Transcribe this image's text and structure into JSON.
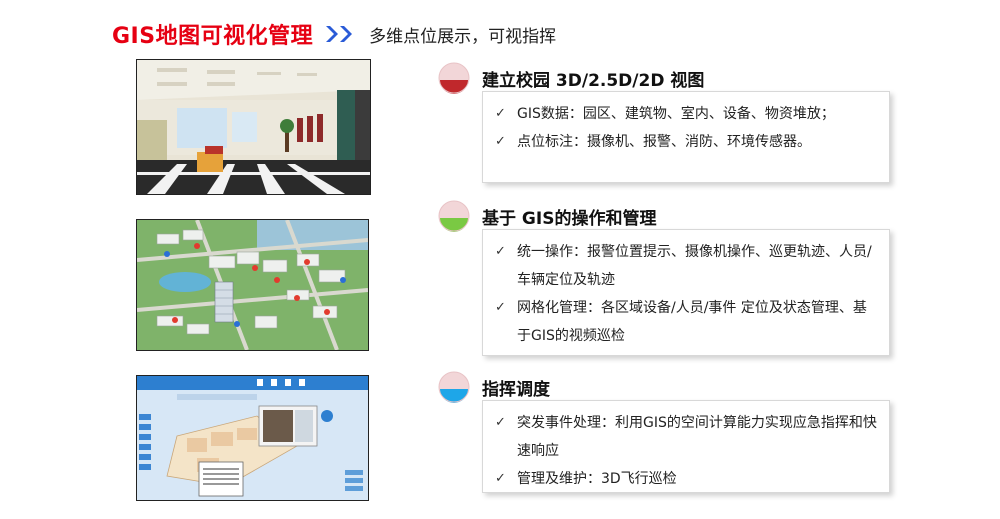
{
  "header": {
    "title": "GIS地图可视化管理",
    "subtitle": "多维点位展示，可视指挥"
  },
  "colors": {
    "title_red": "#e60012",
    "chevron_blue": "#2a5bd7",
    "icon_top": "#f2d6d8",
    "icon_red": "#c0282c",
    "icon_green": "#7ac943",
    "icon_blue": "#1ea6e8"
  },
  "sections": [
    {
      "title": "建立校园 3D/2.5D/2D 视图",
      "icon": "red-semicircle-icon",
      "items": [
        "GIS数据：园区、建筑物、室内、设备、物资堆放；",
        "点位标注：摄像机、报警、消防、环境传感器。"
      ]
    },
    {
      "title": "基于 GIS的操作和管理",
      "icon": "green-semicircle-icon",
      "items": [
        "统一操作：报警位置提示、摄像机操作、巡更轨迹、人员/车辆定位及轨迹",
        "网格化管理：各区域设备/人员/事件  定位及状态管理、基于GIS的视频巡检"
      ]
    },
    {
      "title": "指挥调度",
      "icon": "blue-semicircle-icon",
      "items": [
        "突发事件处理：利用GIS的空间计算能力实现应急指挥和快速响应",
        "管理及维护：3D飞行巡检"
      ]
    }
  ],
  "check_mark": "✓",
  "images": [
    {
      "name": "3d-indoor-hall-image"
    },
    {
      "name": "25d-campus-map-image"
    },
    {
      "name": "2d-dispatch-screen-image"
    }
  ]
}
